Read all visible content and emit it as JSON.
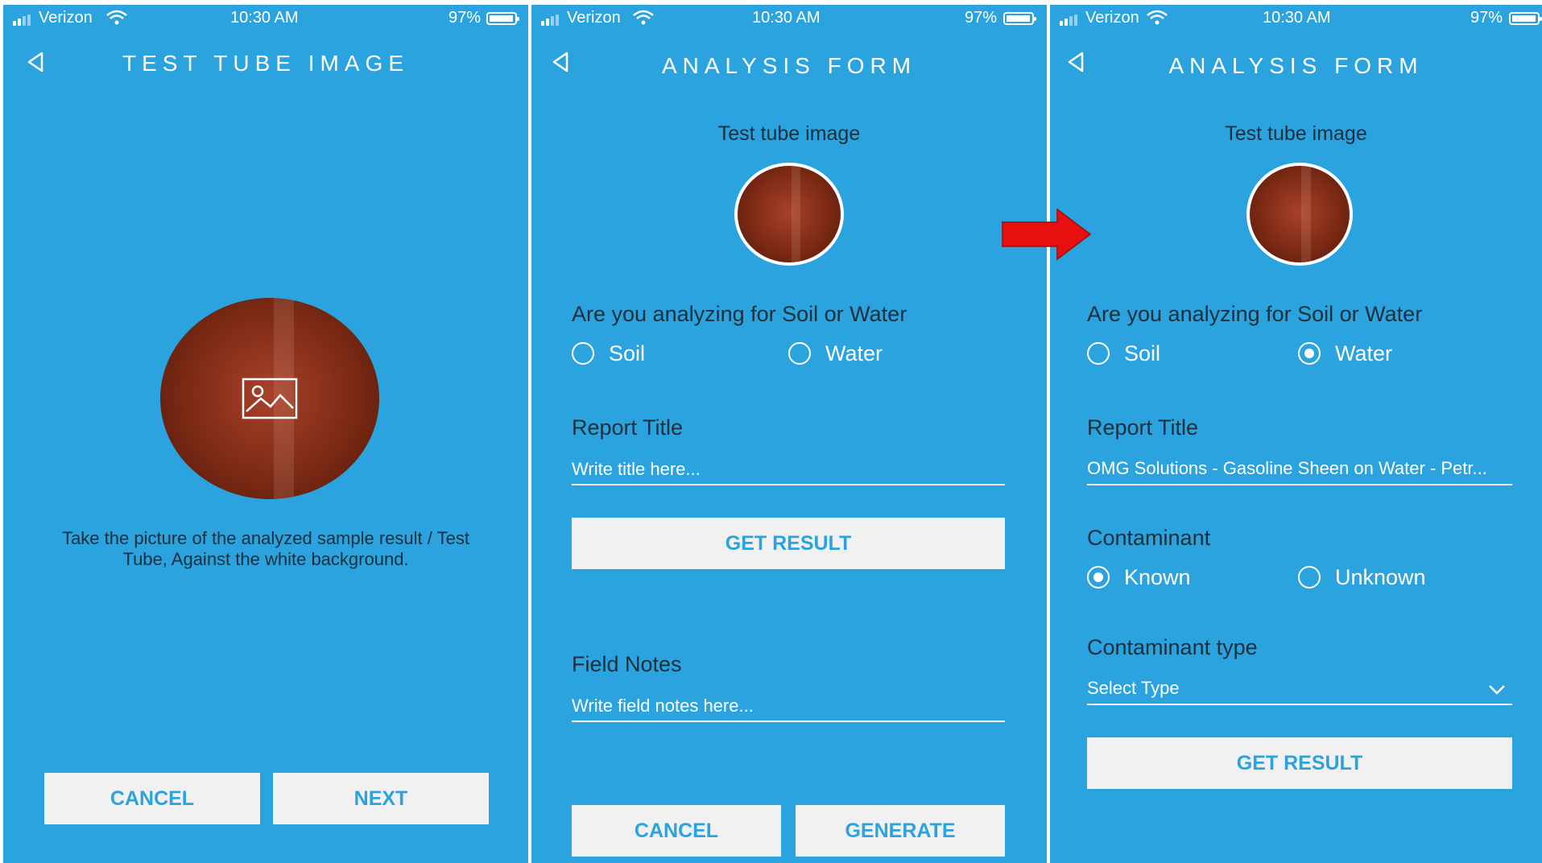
{
  "status": {
    "carrier": "Verizon",
    "time": "10:30 AM",
    "battery": "97%"
  },
  "screen1": {
    "title": "TEST TUBE IMAGE",
    "hint_line1": "Take the picture of the analyzed sample result / Test",
    "hint_line2": "Tube, Against the white background.",
    "image_icon": "image-placeholder-icon",
    "cancel_label": "CANCEL",
    "next_label": "NEXT"
  },
  "screen2": {
    "title": "ANALYSIS FORM",
    "image_label": "Test tube image",
    "question": "Are you analyzing for Soil or Water",
    "option_soil": "Soil",
    "option_water": "Water",
    "selected_medium": "",
    "report_title_label": "Report Title",
    "report_title_placeholder": "Write title here...",
    "get_result_label": "GET RESULT",
    "field_notes_label": "Field Notes",
    "field_notes_placeholder": "Write field notes here...",
    "cancel_label": "CANCEL",
    "generate_label": "GENERATE"
  },
  "screen3": {
    "title": "ANALYSIS FORM",
    "image_label": "Test tube image",
    "question": "Are you analyzing for Soil or Water",
    "option_soil": "Soil",
    "option_water": "Water",
    "selected_medium": "Water",
    "report_title_label": "Report Title",
    "report_title_value": "OMG Solutions - Gasoline Sheen on Water - Petr...",
    "contaminant_label": "Contaminant",
    "option_known": "Known",
    "option_unknown": "Unknown",
    "selected_contaminant": "Known",
    "contaminant_type_label": "Contaminant type",
    "contaminant_type_value": "Select Type",
    "get_result_label": "GET RESULT"
  },
  "colors": {
    "background": "#2aa3de",
    "button_bg": "#f1f1f1",
    "button_text": "#2aa3de",
    "arrow": "#e8100f"
  },
  "icons": [
    "signal-icon",
    "wifi-icon",
    "battery-icon",
    "back-arrow-icon",
    "image-placeholder-icon",
    "chevron-down-icon",
    "red-arrow-icon"
  ]
}
